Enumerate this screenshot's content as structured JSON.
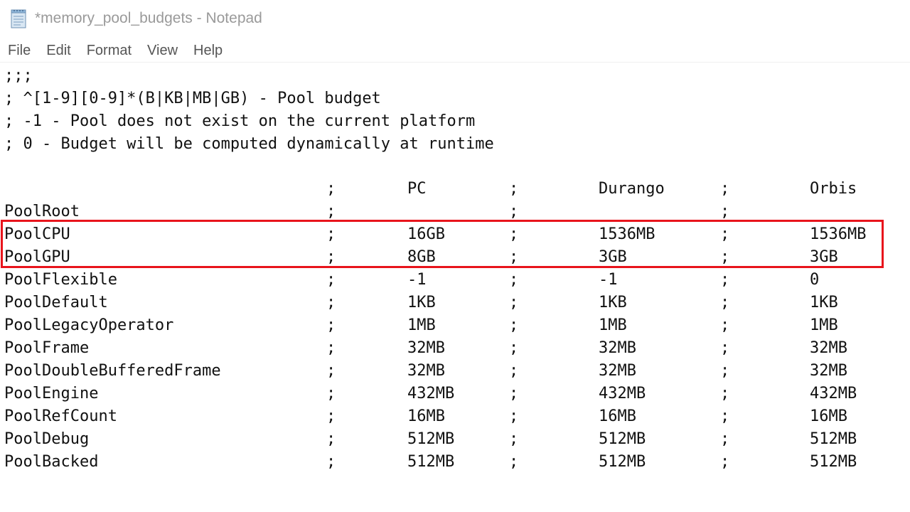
{
  "window": {
    "title": "*memory_pool_budgets - Notepad",
    "icon": "notepad-icon"
  },
  "menu": [
    "File",
    "Edit",
    "Format",
    "View",
    "Help"
  ],
  "comments": [
    ";;;",
    "; ^[1-9][0-9]*(B|KB|MB|GB) - Pool budget",
    "; -1 - Pool does not exist on the current platform",
    "; 0 - Budget will be computed dynamically at runtime"
  ],
  "table": {
    "separator": ";",
    "headers": [
      "",
      "PC",
      "Durango",
      "Orbis"
    ],
    "rows": [
      {
        "name": "PoolRoot",
        "pc": "",
        "durango": "",
        "orbis": ""
      },
      {
        "name": "PoolCPU",
        "pc": "16GB",
        "durango": "1536MB",
        "orbis": "1536MB"
      },
      {
        "name": "PoolGPU",
        "pc": "8GB",
        "durango": "3GB",
        "orbis": "3GB"
      },
      {
        "name": "PoolFlexible",
        "pc": "-1",
        "durango": "-1",
        "orbis": "0"
      },
      {
        "name": "PoolDefault",
        "pc": "1KB",
        "durango": "1KB",
        "orbis": "1KB"
      },
      {
        "name": "PoolLegacyOperator",
        "pc": "1MB",
        "durango": "1MB",
        "orbis": "1MB"
      },
      {
        "name": "PoolFrame",
        "pc": "32MB",
        "durango": "32MB",
        "orbis": "32MB"
      },
      {
        "name": "PoolDoubleBufferedFrame",
        "pc": "32MB",
        "durango": "32MB",
        "orbis": "32MB"
      },
      {
        "name": "PoolEngine",
        "pc": "432MB",
        "durango": "432MB",
        "orbis": "432MB"
      },
      {
        "name": "PoolRefCount",
        "pc": "16MB",
        "durango": "16MB",
        "orbis": "16MB"
      },
      {
        "name": "PoolDebug",
        "pc": "512MB",
        "durango": "512MB",
        "orbis": "512MB"
      },
      {
        "name": "PoolBacked",
        "pc": "512MB",
        "durango": "512MB",
        "orbis": "512MB"
      }
    ]
  },
  "highlight": {
    "rows": [
      "PoolCPU",
      "PoolGPU"
    ],
    "color": "#e8141c"
  }
}
